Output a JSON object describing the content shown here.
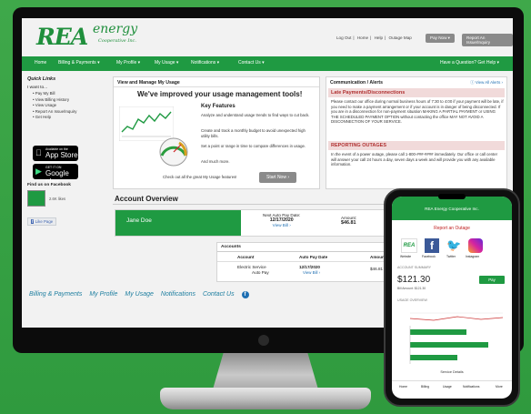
{
  "brand": {
    "name": "REA",
    "energy": "energy",
    "subtitle": "Cooperative Inc."
  },
  "top_links": [
    "Log Out",
    "Home",
    "Help",
    "Outage Map"
  ],
  "buttons": {
    "pay_now": "Pay Now",
    "report_issue": "Report An Issue/Inquiry"
  },
  "nav": {
    "items": [
      "Home",
      "Billing & Payments",
      "My Profile",
      "My Usage",
      "Notifications",
      "Contact Us"
    ],
    "question": "Have a Question? Get Help"
  },
  "sidebar": {
    "title": "Quick Links",
    "want": "I want to...",
    "items": [
      "Pay My Bill",
      "View Billing History",
      "View Usage",
      "Report An Issue/Inquiry",
      "Get Help"
    ],
    "app_store": {
      "line1": "Available on the",
      "line2": "App Store"
    },
    "google_play": {
      "line1": "GET IT ON",
      "line2": "Google play"
    },
    "facebook_title": "Find us on Facebook",
    "fb_likes": "2.6K likes",
    "like_page": "Like Page"
  },
  "usage_card": {
    "title": "View and Manage My Usage",
    "headline": "We've improved your usage management tools!",
    "features_title": "Key Features",
    "f1": "Analyze and understand usage trends to find ways to cut back.",
    "f2": "Create and track a monthly budget to avoid unexpected high utility bills.",
    "f3": "Set a point or range in time to compare differences in usage.",
    "f4": "And much more.",
    "checkout": "Check out all the great My Usage features!",
    "start_btn": "Start Now"
  },
  "alerts": {
    "title": "Communication / Alerts",
    "view_all": "View All Alerts",
    "late_title": "Late Payments/Disconnections",
    "late_text": "Please contact our office during normal business hours of 7:30 to 4:00 if your payment will be late, if you need to make a payment arrangement or if your account is in danger of being disconnected. If you are in a disconnection for non-payment situation MAKING A PARTIAL PAYMENT or USING THE SCHEDULED PAYMENT OPTION without contacting the office MAY NOT AVOID A DISCONNECTION OF YOUR SERVICE.",
    "outage_title": "REPORTING OUTAGES",
    "outage_text": "In the event of a power outage, please call 1-800-###-#### immediately. Our office or call center will answer your call 24 hours a day, seven days a week and will provide you with any available information."
  },
  "account": {
    "title": "Account Overview",
    "name": "Jane Doe",
    "next_label": "Next Auto Pay Date:",
    "next_date": "12/17/2020",
    "view_bill": "View Bill",
    "amount_label": "Amount:",
    "amount": "$46.81",
    "table_title": "Accounts",
    "headers": [
      "Account",
      "Auto Pay Date",
      "Amount"
    ],
    "row": {
      "account": "Electric Service",
      "autopay": "Auto Pay",
      "date": "12/17/2020",
      "amount": "$46.81"
    }
  },
  "footer": [
    "Billing & Payments",
    "My Profile",
    "My Usage",
    "Notifications",
    "Contact Us"
  ],
  "phone": {
    "header": "REA Energy Cooperative Inc.",
    "report": "Report an Outage",
    "icons": [
      "Website",
      "Facebook",
      "Twitter",
      "Instagram"
    ],
    "section1": "ACCOUNT SUMMARY",
    "amount": "$121.30",
    "due": "Bill Amount: $121.30",
    "pay": "Pay",
    "section2": "USAGE OVERVIEW",
    "tabs": [
      "Home",
      "Billing",
      "Usage",
      "Notifications",
      "More"
    ],
    "service": "Service Details"
  },
  "colors": {
    "brand_green": "#1f9a42",
    "alert_red": "#b03030",
    "bg_green": "#3fa84a"
  }
}
